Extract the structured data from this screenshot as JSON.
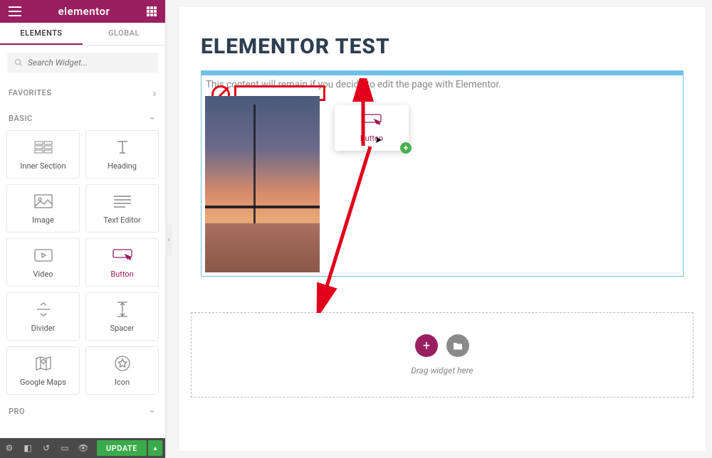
{
  "brand": {
    "logo": "elementor"
  },
  "tabs": {
    "elements": "ELEMENTS",
    "global": "GLOBAL"
  },
  "search": {
    "placeholder": "Search Widget..."
  },
  "sections": {
    "favorites": "FAVORITES",
    "basic": "BASIC",
    "pro": "PRO"
  },
  "widgets": {
    "inner_section": "Inner Section",
    "heading": "Heading",
    "image": "Image",
    "text_editor": "Text Editor",
    "video": "Video",
    "button": "Button",
    "divider": "Divider",
    "spacer": "Spacer",
    "google_maps": "Google Maps",
    "icon": "Icon"
  },
  "footer": {
    "update": "UPDATE"
  },
  "page": {
    "title": "ELEMENTOR TEST",
    "desc": "This content will remain if you decide to edit the page with Elementor."
  },
  "drag_ghost": {
    "label": "Button"
  },
  "dropzone": {
    "text": "Drag widget here"
  },
  "colors": {
    "brand": "#9a1f60",
    "accent": "#6ec1e4",
    "success": "#3aab4b"
  }
}
